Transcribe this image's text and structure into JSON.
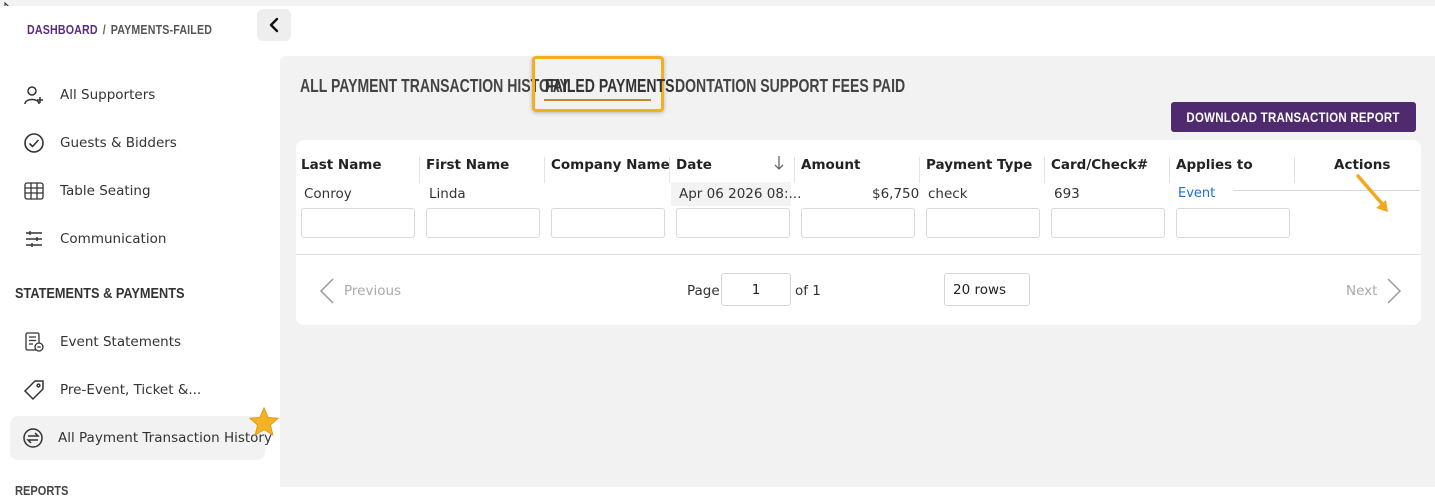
{
  "breadcrumb": {
    "root": "DASHBOARD",
    "separator": "/",
    "current": "PAYMENTS-FAILED"
  },
  "sidebar": {
    "items": [
      {
        "label": "All Supporters",
        "icon": "user-plus-icon"
      },
      {
        "label": "Guests & Bidders",
        "icon": "check-circle-icon"
      },
      {
        "label": "Table Seating",
        "icon": "table-grid-icon"
      },
      {
        "label": "Communication",
        "icon": "sliders-icon"
      }
    ],
    "section_title": "STATEMENTS & PAYMENTS",
    "section_items": [
      {
        "label": "Event Statements",
        "icon": "statement-icon"
      },
      {
        "label": "Pre-Event, Ticket &...",
        "icon": "tag-icon"
      },
      {
        "label": "All Payment Transaction History",
        "icon": "exchange-icon",
        "active": true
      }
    ],
    "next_section_peek": "REPORTS"
  },
  "tabs": [
    {
      "label": "ALL PAYMENT TRANSACTION HISTORY",
      "active": false
    },
    {
      "label": "FAILED PAYMENTS",
      "active": true
    },
    {
      "label": "DONTATION SUPPORT FEES PAID",
      "active": false
    }
  ],
  "download_button": "DOWNLOAD TRANSACTION REPORT",
  "table": {
    "columns": [
      "Last Name",
      "First Name",
      "Company Name",
      "Date",
      "Amount",
      "Payment Type",
      "Card/Check#",
      "Applies to",
      "Actions"
    ],
    "rows": [
      {
        "last_name": "Conroy",
        "first_name": "Linda",
        "company": "",
        "date": "Apr 06 2026 08:...",
        "amount": "$6,750",
        "payment_type": "check",
        "card_check": "693",
        "applies_to": "Event"
      }
    ]
  },
  "pagination": {
    "previous": "Previous",
    "next": "Next",
    "page_label": "Page",
    "page_value": "1",
    "of_label": "of 1",
    "rows_label": "20 rows"
  },
  "colors": {
    "brand": "#4f2a6e",
    "highlight": "#f2b01e",
    "link": "#1a6fd1"
  }
}
